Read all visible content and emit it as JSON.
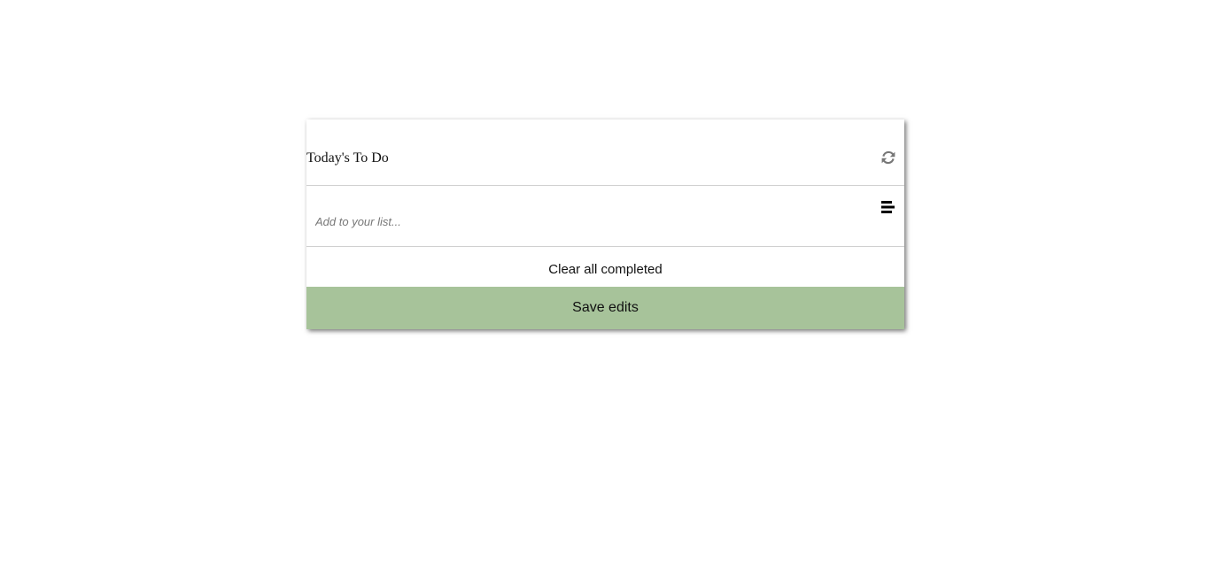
{
  "app": {
    "title": "Today's To Do"
  },
  "header": {
    "refresh_icon": "refresh-icon"
  },
  "add_item": {
    "placeholder": "Add to your list...",
    "value": "",
    "menu_icon": "list-menu-icon"
  },
  "actions": {
    "clear_label": "Clear all completed",
    "save_label": "Save edits"
  },
  "colors": {
    "save_button_bg": "#a7c39a",
    "divider": "#d0d0d0",
    "refresh_icon": "#777777",
    "menu_icon": "#000000"
  }
}
